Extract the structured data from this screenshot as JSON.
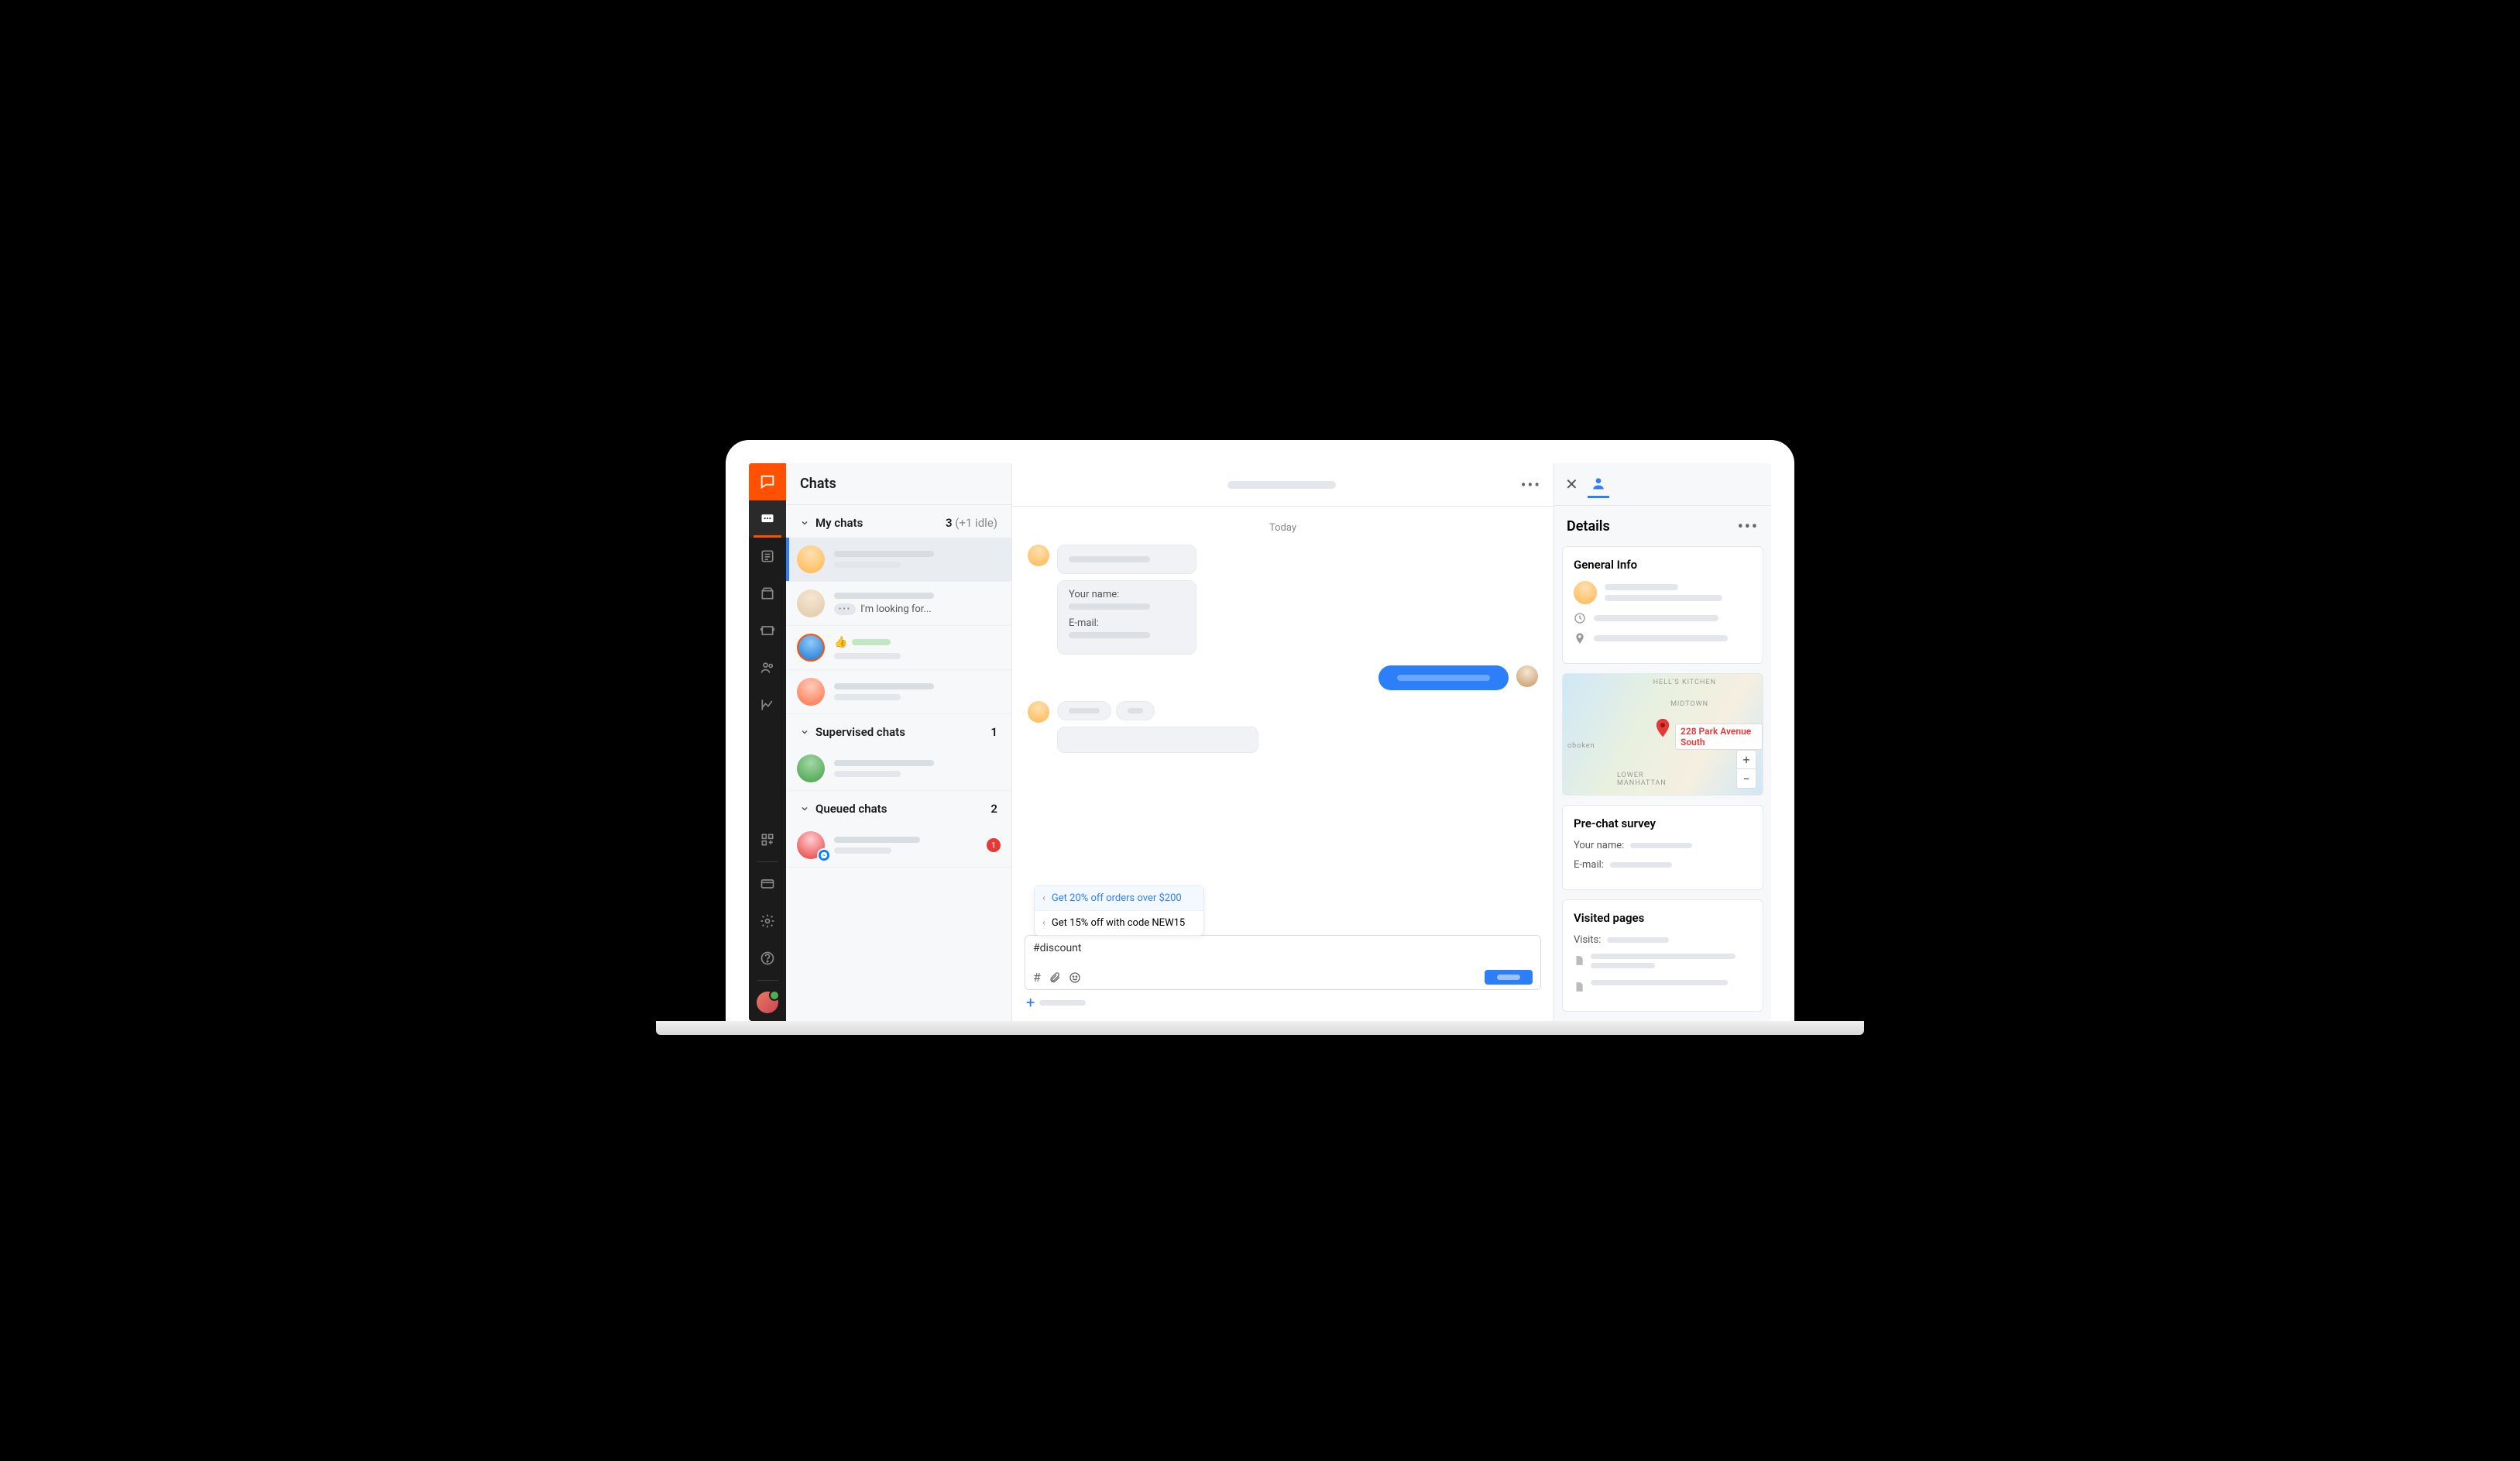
{
  "sidebar": {
    "title": "Chats"
  },
  "groups": {
    "my_chats": {
      "label": "My chats",
      "count": "3",
      "idle": "(+1 idle)"
    },
    "supervised": {
      "label": "Supervised chats",
      "count": "1"
    },
    "queued": {
      "label": "Queued chats",
      "count": "2"
    }
  },
  "chat_previews": {
    "row2": "I'm looking  for...",
    "queued_badge": "1"
  },
  "conversation": {
    "day_label": "Today",
    "form": {
      "name_label": "Your name:",
      "email_label": "E-mail:"
    }
  },
  "suggestions": {
    "opt1": "Get 20% off orders over $200",
    "opt2": "Get 15% off with code NEW15"
  },
  "composer": {
    "text": "#discount"
  },
  "details": {
    "title": "Details",
    "general_info": "General Info",
    "map_address": "228 Park Avenue South",
    "map_labels": {
      "hoboken": "oboken",
      "midtown": "MIDTOWN",
      "hells": "HELL'S KITCHEN",
      "lower": "LOWER\nMANHATTAN"
    },
    "prechat": {
      "title": "Pre-chat survey",
      "name": "Your name:",
      "email": "E-mail:"
    },
    "visited": {
      "title": "Visited pages",
      "visits_label": "Visits:"
    }
  }
}
